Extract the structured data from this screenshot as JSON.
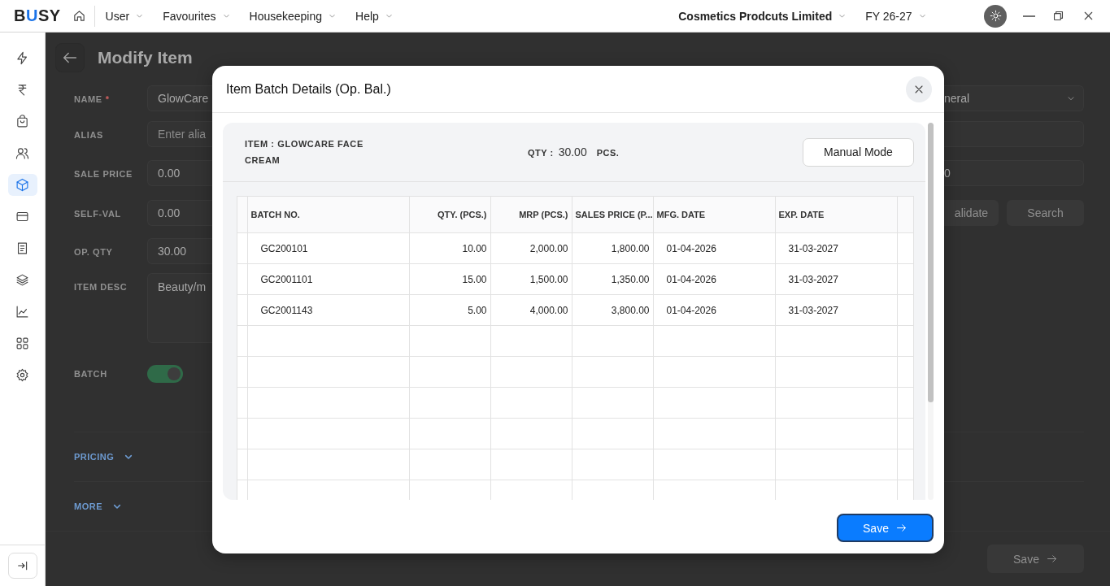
{
  "app": {
    "logo": "BUSY",
    "menus": [
      {
        "label": "User"
      },
      {
        "label": "Favourites"
      },
      {
        "label": "Housekeeping"
      },
      {
        "label": "Help"
      }
    ],
    "company": "Cosmetics Prodcuts Limited",
    "fiscal_year": "FY 26-27"
  },
  "sidebar": {
    "items": [
      {
        "kind": "bolt",
        "selected": false
      },
      {
        "kind": "rupee",
        "selected": false
      },
      {
        "kind": "bag",
        "selected": false
      },
      {
        "kind": "users",
        "selected": false
      },
      {
        "kind": "cube",
        "selected": true
      },
      {
        "kind": "card",
        "selected": false
      },
      {
        "kind": "receipt",
        "selected": false
      },
      {
        "kind": "layers",
        "selected": false
      },
      {
        "kind": "chart",
        "selected": false
      },
      {
        "kind": "grid",
        "selected": false
      },
      {
        "kind": "gear",
        "selected": false
      }
    ]
  },
  "page": {
    "title": "Modify Item",
    "fields": [
      {
        "kind": "text",
        "label": "NAME",
        "marker": "*",
        "value": "GlowCare"
      },
      {
        "kind": "text",
        "label": "ALIAS",
        "placeholder": "Enter alia"
      },
      {
        "kind": "text",
        "label": "SALE PRICE",
        "value": "0.00"
      },
      {
        "kind": "text",
        "label": "SELF-VAL",
        "value": "0.00"
      },
      {
        "kind": "text",
        "label": "OP. QTY",
        "value": "30.00"
      },
      {
        "kind": "textarea",
        "label": "ITEM DESC",
        "value": "Beauty/m"
      },
      {
        "kind": "toggle",
        "label": "BATCH",
        "on": true
      }
    ],
    "sections": [
      {
        "label": "PRICING",
        "expanded": false
      },
      {
        "label": "MORE",
        "expanded": false
      }
    ],
    "right_fields": [
      {
        "kind": "select",
        "value": "neral"
      },
      {
        "kind": "text"
      },
      {
        "kind": "text",
        "value": "0"
      }
    ],
    "right_buttons": [
      "alidate",
      "Search"
    ],
    "save_button": "Save"
  },
  "dialog": {
    "title": "Item Batch Details (Op. Bal.)",
    "item_label": "ITEM :",
    "item_name": "GLOWCARE FACE CREAM",
    "qty_label": "QTY :",
    "qty": "30.00",
    "unit": "PCS.",
    "mode_button": "Manual Mode",
    "columns": [
      "BATCH NO.",
      "QTY. (PCS.)",
      "MRP (PCS.)",
      "SALES PRICE (P...",
      "MFG. DATE",
      "EXP. DATE"
    ],
    "rows": [
      [
        "GC200101",
        "10.00",
        "2,000.00",
        "1,800.00",
        "01-04-2026",
        "31-03-2027"
      ],
      [
        "GC2001101",
        "15.00",
        "1,500.00",
        "1,350.00",
        "01-04-2026",
        "31-03-2027"
      ],
      [
        "GC2001143",
        "5.00",
        "4,000.00",
        "3,800.00",
        "01-04-2026",
        "31-03-2027"
      ]
    ],
    "save_button": "Save"
  }
}
